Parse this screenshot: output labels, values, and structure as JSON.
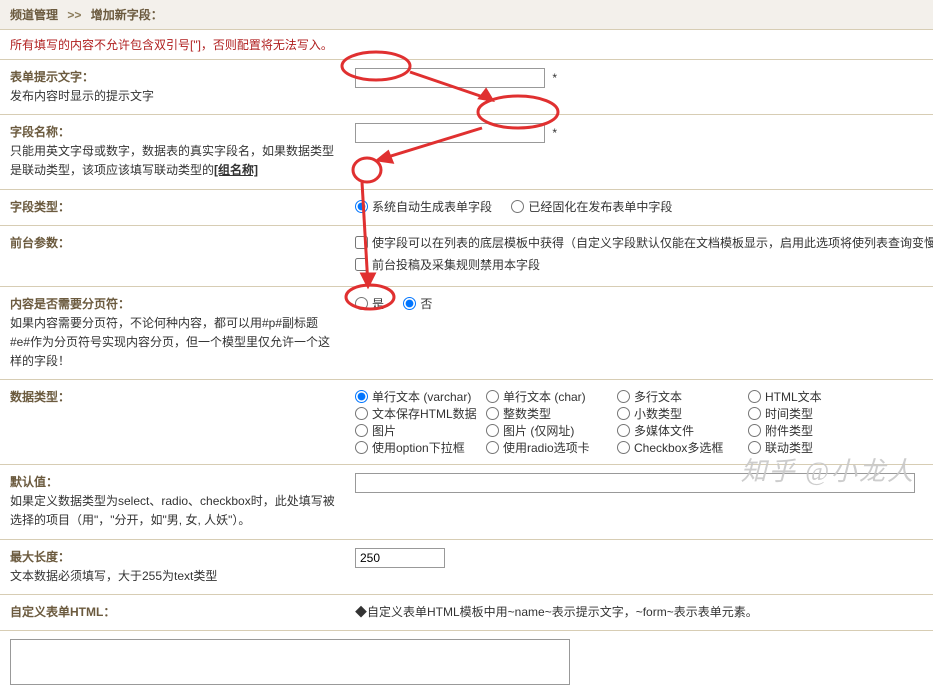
{
  "breadcrumb": {
    "a": "频道管理",
    "sep": ">>",
    "b": "增加新字段："
  },
  "warning": "所有填写的内容不允许包含双引号[\"]，否则配置将无法写入。",
  "rows": {
    "prompt": {
      "title": "表单提示文字：",
      "desc": "发布内容时显示的提示文字",
      "star": " *"
    },
    "name": {
      "title": "字段名称：",
      "descA": "只能用英文字母或数字，数据表的真实字段名，如果数据类型是联动类型，该项应该填写联动类型的",
      "link": "[组名称]",
      "star": " *"
    },
    "ftype": {
      "title": "字段类型：",
      "opt1": "系统自动生成表单字段",
      "opt2": "已经固化在发布表单中字段"
    },
    "front": {
      "title": "前台参数：",
      "opt1": "使字段可以在列表的底层模板中获得（自定义字段默认仅能在文档模板显示，启用此选项将使列表查询变慢，如无必要请不要选择）",
      "opt2": "前台投稿及采集规则禁用本字段"
    },
    "pagebreak": {
      "title": "内容是否需要分页符：",
      "desc": "如果内容需要分页符，不论何种内容，都可以用#p#副标题#e#作为分页符号实现内容分页，但一个模型里仅允许一个这样的字段！",
      "yes": "是",
      "no": "否"
    },
    "dtype": {
      "title": "数据类型：",
      "r1": [
        "单行文本 (varchar)",
        "单行文本 (char)",
        "多行文本",
        "HTML文本"
      ],
      "r2": [
        "文本保存HTML数据",
        "整数类型",
        "小数类型",
        "时间类型"
      ],
      "r3": [
        "图片",
        "图片 (仅网址)",
        "多媒体文件",
        "附件类型"
      ],
      "r4": [
        "使用option下拉框",
        "使用radio选项卡",
        "Checkbox多选框",
        "联动类型"
      ]
    },
    "default": {
      "title": "默认值：",
      "desc": "如果定义数据类型为select、radio、checkbox时，此处填写被选择的项目（用\"，\"分开，如\"男, 女, 人妖\"）。"
    },
    "maxlen": {
      "title": "最大长度：",
      "desc": "文本数据必须填写，大于255为text类型",
      "value": "250"
    },
    "customhtml": {
      "title": "自定义表单HTML：",
      "note": "◆自定义表单HTML模板中用~name~表示提示文字，~form~表示表单元素。"
    }
  },
  "watermark": "知乎 @小龙人"
}
